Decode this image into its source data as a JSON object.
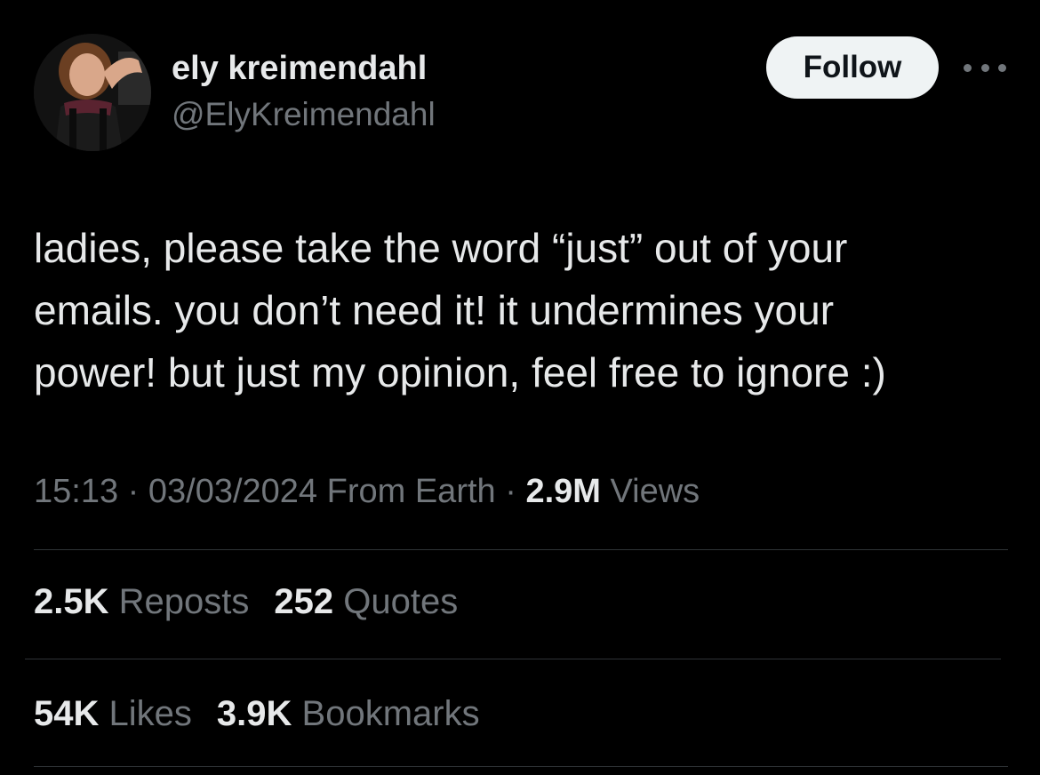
{
  "author": {
    "display_name": "ely kreimendahl",
    "handle": "@ElyKreimendahl",
    "avatar_icon": "profile-photo"
  },
  "actions": {
    "follow_label": "Follow",
    "more_icon": "more-horizontal-icon"
  },
  "tweet": {
    "text": "ladies, please take the word “just” out of your\nemails. you don’t need it! it undermines your\npower! but just my opinion, feel free to ignore :)"
  },
  "meta": {
    "time": "15:13",
    "separator": "·",
    "date": "03/03/2024",
    "source": "From Earth",
    "views_count": "2.9M",
    "views_label": "Views"
  },
  "engagement": {
    "reposts_count": "2.5K",
    "reposts_label": "Reposts",
    "quotes_count": "252",
    "quotes_label": "Quotes",
    "likes_count": "54K",
    "likes_label": "Likes",
    "bookmarks_count": "3.9K",
    "bookmarks_label": "Bookmarks"
  },
  "colors": {
    "background": "#000000",
    "primary_text": "#e7e9ea",
    "secondary_text": "#71767b",
    "divider": "#2f3336",
    "follow_button_bg": "#eff3f4"
  }
}
